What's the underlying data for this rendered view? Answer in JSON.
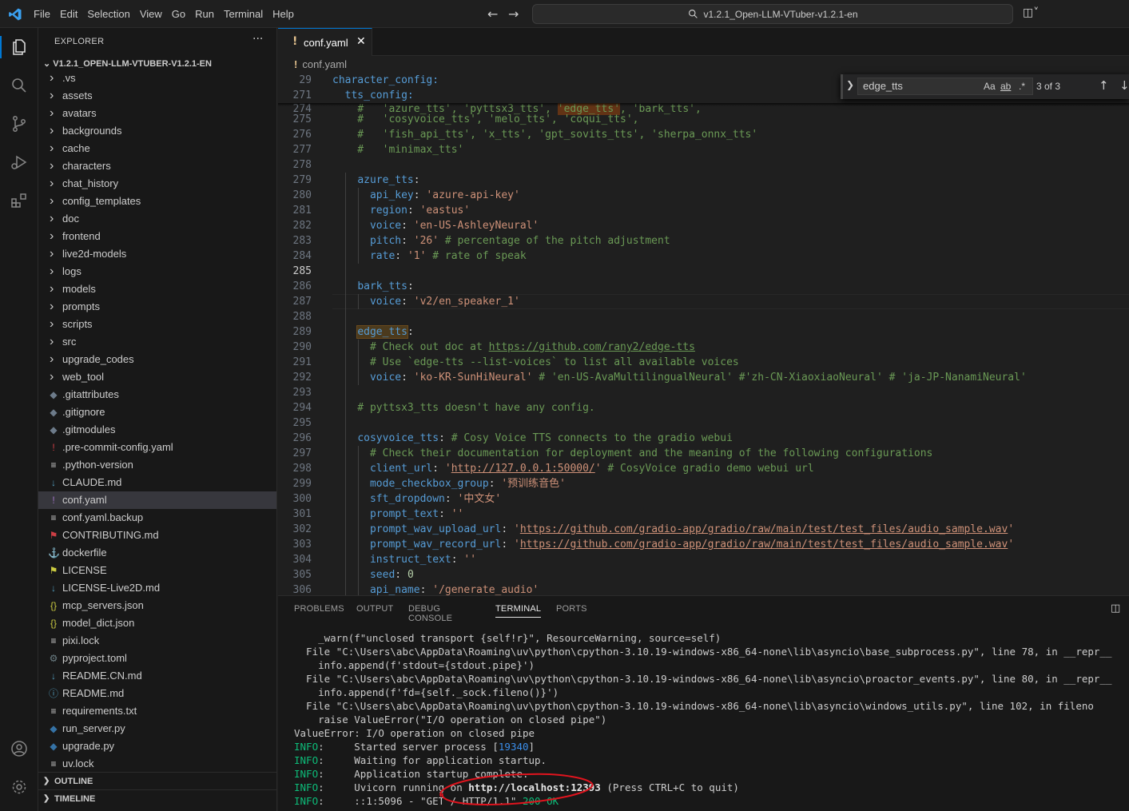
{
  "menu": [
    "File",
    "Edit",
    "Selection",
    "View",
    "Go",
    "Run",
    "Terminal",
    "Help"
  ],
  "command_center": "v1.2.1_Open-LLM-VTuber-v1.2.1-en",
  "explorer": {
    "title": "EXPLORER",
    "more": "···",
    "root": "V1.2.1_OPEN-LLM-VTUBER-V1.2.1-EN",
    "items": [
      {
        "label": ".vs",
        "type": "folder",
        "icon": "chevron-right-icon"
      },
      {
        "label": "assets",
        "type": "folder",
        "icon": "chevron-right-icon"
      },
      {
        "label": "avatars",
        "type": "folder",
        "icon": "chevron-right-icon"
      },
      {
        "label": "backgrounds",
        "type": "folder",
        "icon": "chevron-right-icon"
      },
      {
        "label": "cache",
        "type": "folder",
        "icon": "chevron-right-icon"
      },
      {
        "label": "characters",
        "type": "folder",
        "icon": "chevron-right-icon"
      },
      {
        "label": "chat_history",
        "type": "folder",
        "icon": "chevron-right-icon"
      },
      {
        "label": "config_templates",
        "type": "folder",
        "icon": "chevron-right-icon"
      },
      {
        "label": "doc",
        "type": "folder",
        "icon": "chevron-right-icon"
      },
      {
        "label": "frontend",
        "type": "folder",
        "icon": "chevron-right-icon"
      },
      {
        "label": "live2d-models",
        "type": "folder",
        "icon": "chevron-right-icon"
      },
      {
        "label": "logs",
        "type": "folder",
        "icon": "chevron-right-icon"
      },
      {
        "label": "models",
        "type": "folder",
        "icon": "chevron-right-icon"
      },
      {
        "label": "prompts",
        "type": "folder",
        "icon": "chevron-right-icon"
      },
      {
        "label": "scripts",
        "type": "folder",
        "icon": "chevron-right-icon"
      },
      {
        "label": "src",
        "type": "folder",
        "icon": "chevron-right-icon"
      },
      {
        "label": "upgrade_codes",
        "type": "folder",
        "icon": "chevron-right-icon"
      },
      {
        "label": "web_tool",
        "type": "folder",
        "icon": "chevron-right-icon"
      },
      {
        "label": ".gitattributes",
        "type": "file",
        "icon": "git-icon",
        "glyph": "◆",
        "color": "#6d7b8a"
      },
      {
        "label": ".gitignore",
        "type": "file",
        "icon": "git-icon",
        "glyph": "◆",
        "color": "#6d7b8a"
      },
      {
        "label": ".gitmodules",
        "type": "file",
        "icon": "git-icon",
        "glyph": "◆",
        "color": "#6d7b8a"
      },
      {
        "label": ".pre-commit-config.yaml",
        "type": "file",
        "icon": "yaml-icon",
        "glyph": "!",
        "color": "#cc3e44"
      },
      {
        "label": ".python-version",
        "type": "file",
        "icon": "text-file-icon",
        "glyph": "≡",
        "color": "#cccccc"
      },
      {
        "label": "CLAUDE.md",
        "type": "file",
        "icon": "markdown-icon",
        "glyph": "↓",
        "color": "#519aba"
      },
      {
        "label": "conf.yaml",
        "type": "file",
        "icon": "yaml-icon",
        "glyph": "!",
        "color": "#a074c4",
        "selected": true
      },
      {
        "label": "conf.yaml.backup",
        "type": "file",
        "icon": "text-file-icon",
        "glyph": "≡",
        "color": "#cccccc"
      },
      {
        "label": "CONTRIBUTING.md",
        "type": "file",
        "icon": "contributing-icon",
        "glyph": "⚑",
        "color": "#cc3e44"
      },
      {
        "label": "dockerfile",
        "type": "file",
        "icon": "docker-icon",
        "glyph": "⚓",
        "color": "#519aba"
      },
      {
        "label": "LICENSE",
        "type": "file",
        "icon": "license-icon",
        "glyph": "⚑",
        "color": "#cbcb41"
      },
      {
        "label": "LICENSE-Live2D.md",
        "type": "file",
        "icon": "markdown-icon",
        "glyph": "↓",
        "color": "#519aba"
      },
      {
        "label": "mcp_servers.json",
        "type": "file",
        "icon": "json-icon",
        "glyph": "{}",
        "color": "#cbcb41"
      },
      {
        "label": "model_dict.json",
        "type": "file",
        "icon": "json-icon",
        "glyph": "{}",
        "color": "#cbcb41"
      },
      {
        "label": "pixi.lock",
        "type": "file",
        "icon": "lock-file-icon",
        "glyph": "≡",
        "color": "#cccccc"
      },
      {
        "label": "pyproject.toml",
        "type": "file",
        "icon": "toml-icon",
        "glyph": "⚙",
        "color": "#6d8086"
      },
      {
        "label": "README.CN.md",
        "type": "file",
        "icon": "markdown-icon",
        "glyph": "↓",
        "color": "#519aba"
      },
      {
        "label": "README.md",
        "type": "file",
        "icon": "info-icon",
        "glyph": "ⓘ",
        "color": "#519aba"
      },
      {
        "label": "requirements.txt",
        "type": "file",
        "icon": "text-file-icon",
        "glyph": "≡",
        "color": "#cccccc"
      },
      {
        "label": "run_server.py",
        "type": "file",
        "icon": "python-icon",
        "glyph": "◆",
        "color": "#3572a5"
      },
      {
        "label": "upgrade.py",
        "type": "file",
        "icon": "python-icon",
        "glyph": "◆",
        "color": "#3572a5"
      },
      {
        "label": "uv.lock",
        "type": "file",
        "icon": "lock-file-icon",
        "glyph": "≡",
        "color": "#cccccc"
      }
    ],
    "outline": "OUTLINE",
    "timeline": "TIMELINE"
  },
  "editor": {
    "tab_title": "conf.yaml",
    "breadcrumb": "conf.yaml",
    "sticky": [
      {
        "ln": "29",
        "text": "character_config:"
      },
      {
        "ln": "271",
        "text": "  tts_config:"
      }
    ]
  },
  "find": {
    "query": "edge_tts",
    "match_case": "Aa",
    "whole_word": "ab",
    "regex": ".*",
    "count": "3 of 3"
  },
  "panel": {
    "tabs": [
      "PROBLEMS",
      "OUTPUT",
      "DEBUG CONSOLE",
      "TERMINAL",
      "PORTS"
    ],
    "active_tab": "TERMINAL"
  },
  "colors": {
    "accent": "#0078d4",
    "annotation": "#e0141e"
  }
}
